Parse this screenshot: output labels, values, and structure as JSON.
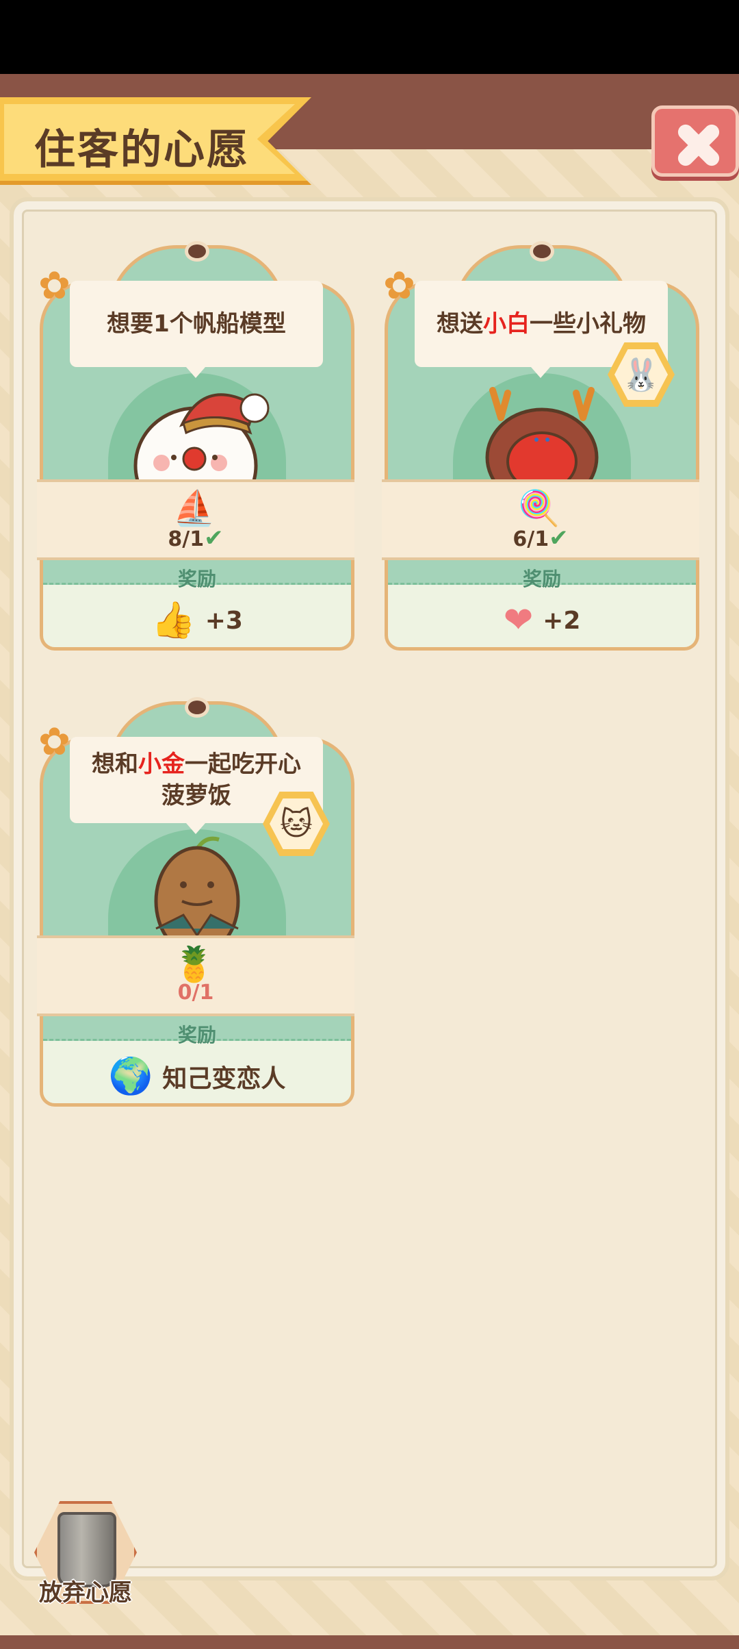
{
  "header": {
    "title": "住客的心愿"
  },
  "close_button": {
    "icon": "close-icon"
  },
  "wishes": [
    {
      "request_parts": [
        "想要1个帆船模型"
      ],
      "highlight": "",
      "character": "snowman-guest",
      "item": {
        "icon": "sailboat-model-icon",
        "count": "8/1",
        "done": true
      },
      "reward_label": "奖励",
      "reward": {
        "icon": "thumbs-up-icon",
        "value": "+3"
      }
    },
    {
      "request_parts": [
        "想送",
        "小白",
        "一些小礼物"
      ],
      "highlight": "小白",
      "character": "reindeer-guest",
      "badge": "bunny-badge",
      "item": {
        "icon": "lollipop-icon",
        "count": "6/1",
        "done": true
      },
      "reward_label": "奖励",
      "reward": {
        "icon": "heart-icon",
        "value": "+2"
      }
    },
    {
      "request_parts": [
        "想和",
        "小金",
        "一起吃开心",
        "菠萝饭"
      ],
      "highlight": "小金",
      "character": "potato-guest",
      "badge": "cat-badge",
      "item": {
        "icon": "pineapple-rice-icon",
        "count": "0/1",
        "done": false
      },
      "reward_label": "奖励",
      "reward": {
        "icon": "earth-globe-icon",
        "value": "知己变恋人"
      }
    }
  ],
  "footer": {
    "abandon_label": "放弃心愿"
  }
}
